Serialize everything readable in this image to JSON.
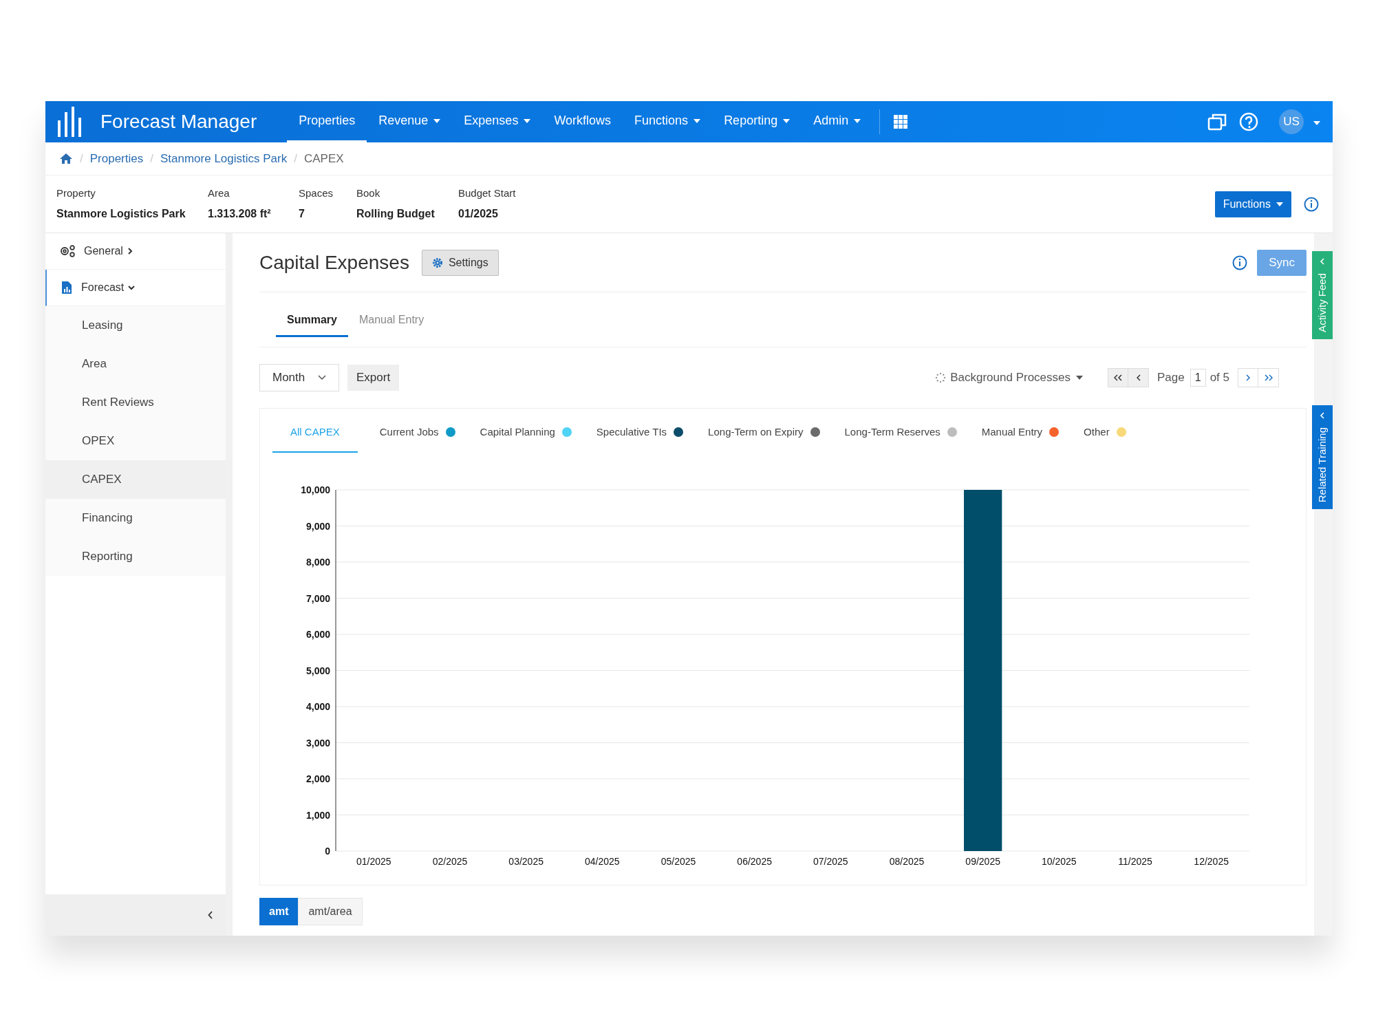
{
  "header": {
    "brand": "Forecast Manager",
    "avatar": "US",
    "nav": [
      {
        "label": "Properties",
        "dropdown": false,
        "selected": true
      },
      {
        "label": "Revenue",
        "dropdown": true,
        "selected": false
      },
      {
        "label": "Expenses",
        "dropdown": true,
        "selected": false
      },
      {
        "label": "Workflows",
        "dropdown": false,
        "selected": false
      },
      {
        "label": "Functions",
        "dropdown": true,
        "selected": false
      },
      {
        "label": "Reporting",
        "dropdown": true,
        "selected": false
      },
      {
        "label": "Admin",
        "dropdown": true,
        "selected": false
      }
    ]
  },
  "breadcrumb": {
    "separator": "/",
    "items": [
      "Properties",
      "Stanmore Logistics Park",
      "CAPEX"
    ]
  },
  "property_info": [
    {
      "label": "Property",
      "value": "Stanmore Logistics Park"
    },
    {
      "label": "Area",
      "value": "1.313.208 ft²"
    },
    {
      "label": "Spaces",
      "value": "7"
    },
    {
      "label": "Book",
      "value": "Rolling Budget"
    },
    {
      "label": "Budget Start",
      "value": "01/2025"
    }
  ],
  "functions_button": "Functions",
  "sidebar": {
    "items": [
      {
        "label": "General",
        "kind": "gears",
        "expanded": false
      },
      {
        "label": "Forecast",
        "kind": "report",
        "expanded": true,
        "children": [
          {
            "label": "Leasing",
            "selected": false
          },
          {
            "label": "Area",
            "selected": false
          },
          {
            "label": "Rent Reviews",
            "selected": false
          },
          {
            "label": "OPEX",
            "selected": false
          },
          {
            "label": "CAPEX",
            "selected": true
          },
          {
            "label": "Financing",
            "selected": false
          },
          {
            "label": "Reporting",
            "selected": false
          }
        ]
      }
    ]
  },
  "main": {
    "title": "Capital Expenses",
    "settings_button": "Settings",
    "sync_button": "Sync",
    "tabs": [
      {
        "label": "Summary",
        "selected": true
      },
      {
        "label": "Manual Entry",
        "selected": false
      }
    ],
    "period_select": {
      "value": "Month"
    },
    "export_button": "Export",
    "background_processes": "Background Processes",
    "pagination": {
      "label": "Page",
      "page": "1",
      "total": "of 5"
    },
    "legend": [
      {
        "label": "All CAPEX",
        "selected": true
      },
      {
        "label": "Current Jobs",
        "color": "#0f9bc7",
        "selected": false
      },
      {
        "label": "Capital Planning",
        "color": "#4fd3f7",
        "selected": false
      },
      {
        "label": "Speculative TIs",
        "color": "#0b4d6b",
        "selected": false
      },
      {
        "label": "Long-Term on Expiry",
        "color": "#6b6b6b",
        "selected": false
      },
      {
        "label": "Long-Term Reserves",
        "color": "#bdbdbd",
        "selected": false
      },
      {
        "label": "Manual Entry",
        "color": "#f4622c",
        "selected": false
      },
      {
        "label": "Other",
        "color": "#f8d97a",
        "selected": false
      }
    ],
    "chart_data": {
      "type": "bar",
      "categories": [
        "01/2025",
        "02/2025",
        "03/2025",
        "04/2025",
        "05/2025",
        "06/2025",
        "07/2025",
        "08/2025",
        "09/2025",
        "10/2025",
        "11/2025",
        "12/2025"
      ],
      "grid": true,
      "series": [
        {
          "color": "#004e6a",
          "values": [
            0,
            0,
            0,
            0,
            0,
            0,
            0,
            0,
            10000,
            0,
            0,
            0
          ]
        }
      ],
      "ylim": [
        0,
        10000
      ],
      "yticks": [
        {
          "value": 0,
          "label": "0"
        },
        {
          "value": 1000,
          "label": "1,000"
        },
        {
          "value": 2000,
          "label": "2,000"
        },
        {
          "value": 3000,
          "label": "3,000"
        },
        {
          "value": 4000,
          "label": "4,000"
        },
        {
          "value": 5000,
          "label": "5,000"
        },
        {
          "value": 6000,
          "label": "6,000"
        },
        {
          "value": 7000,
          "label": "7,000"
        },
        {
          "value": 8000,
          "label": "8,000"
        },
        {
          "value": 9000,
          "label": "9,000"
        },
        {
          "value": 10000,
          "label": "10,000"
        }
      ]
    },
    "unit_toggle": [
      {
        "label": "amt",
        "selected": true
      },
      {
        "label": "amt/area",
        "selected": false
      }
    ]
  },
  "side_tabs": [
    {
      "label": "Activity Feed",
      "color": "#27b17a"
    },
    {
      "label": "Related Training",
      "color": "#0a72d1"
    }
  ]
}
